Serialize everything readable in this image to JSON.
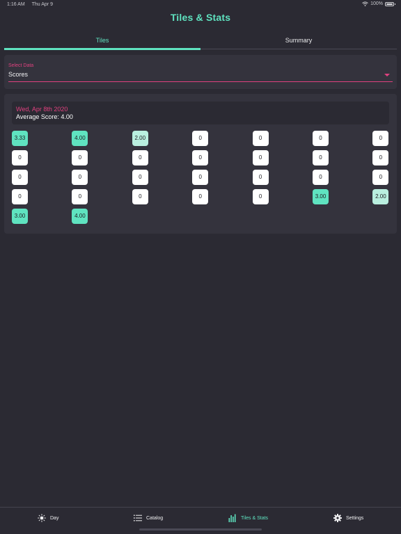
{
  "status_bar": {
    "time": "1:16 AM",
    "date": "Thu Apr 9",
    "battery": "100%"
  },
  "header": {
    "title": "Tiles & Stats"
  },
  "tabs": [
    {
      "label": "Tiles",
      "active": true
    },
    {
      "label": "Summary",
      "active": false
    }
  ],
  "select": {
    "label": "Select Data",
    "value": "Scores"
  },
  "summary": {
    "date": "Wed, Apr 8th 2020",
    "average": "Average Score: 4.00"
  },
  "tiles": [
    {
      "value": "3.33",
      "level": "hi"
    },
    {
      "value": "4.00",
      "level": "hi"
    },
    {
      "value": "2.00",
      "level": "lo"
    },
    {
      "value": "0",
      "level": "none"
    },
    {
      "value": "0",
      "level": "none"
    },
    {
      "value": "0",
      "level": "none"
    },
    {
      "value": "0",
      "level": "none"
    },
    {
      "value": "0",
      "level": "none"
    },
    {
      "value": "0",
      "level": "none"
    },
    {
      "value": "0",
      "level": "none"
    },
    {
      "value": "0",
      "level": "none"
    },
    {
      "value": "0",
      "level": "none"
    },
    {
      "value": "0",
      "level": "none"
    },
    {
      "value": "0",
      "level": "none"
    },
    {
      "value": "0",
      "level": "none"
    },
    {
      "value": "0",
      "level": "none"
    },
    {
      "value": "0",
      "level": "none"
    },
    {
      "value": "0",
      "level": "none"
    },
    {
      "value": "0",
      "level": "none"
    },
    {
      "value": "0",
      "level": "none"
    },
    {
      "value": "0",
      "level": "none"
    },
    {
      "value": "0",
      "level": "none"
    },
    {
      "value": "0",
      "level": "none"
    },
    {
      "value": "0",
      "level": "none"
    },
    {
      "value": "0",
      "level": "none"
    },
    {
      "value": "0",
      "level": "none"
    },
    {
      "value": "3.00",
      "level": "hi"
    },
    {
      "value": "2.00",
      "level": "lo"
    },
    {
      "value": "3.00",
      "level": "hi"
    },
    {
      "value": "4.00",
      "level": "hi"
    }
  ],
  "tab_bar": [
    {
      "label": "Day",
      "icon": "sun-icon",
      "active": false
    },
    {
      "label": "Catalog",
      "icon": "list-icon",
      "active": false
    },
    {
      "label": "Tiles & Stats",
      "icon": "bar-chart-icon",
      "active": true
    },
    {
      "label": "Settings",
      "icon": "gear-icon",
      "active": false
    }
  ],
  "colors": {
    "background": "#2b2a33",
    "card": "#34333d",
    "accent": "#5fe3c0",
    "accent_light": "#b9efdf",
    "pink": "#e0417f"
  }
}
